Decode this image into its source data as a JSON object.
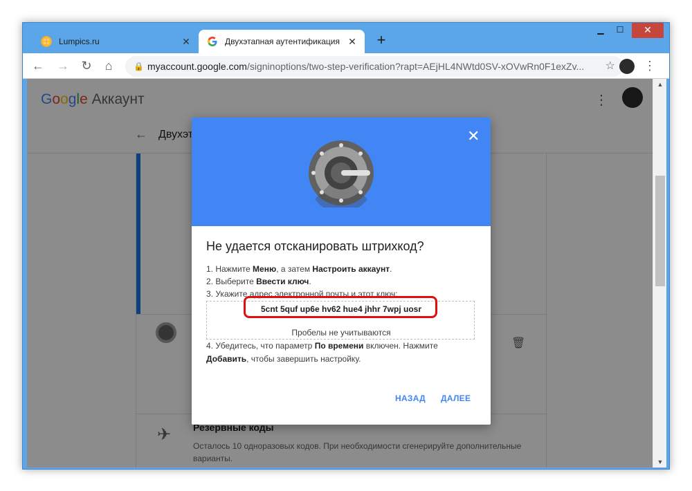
{
  "browser": {
    "tabs": [
      {
        "title": "Lumpics.ru",
        "favicon": "orange-slice-icon",
        "favicon_color": "#f5a623"
      },
      {
        "title": "Двухэтапная аутентификация",
        "favicon": "google-g-icon"
      }
    ],
    "url_host": "myaccount.google.com",
    "url_path": "/signinoptions/two-step-verification?rapt=AEjHL4NWtd0SV-xOVwRn0F1exZv..."
  },
  "page": {
    "logo_google": "Google",
    "logo_suffix": "Аккаунт",
    "subtitle": "Двухэтапная аутентификация",
    "backup": {
      "title": "Резервные коды",
      "description": "Осталось 10 одноразовых кодов. При необходимости сгенерируйте дополнительные варианты."
    }
  },
  "dialog": {
    "title": "Не удается отсканировать штрихкод?",
    "step1_prefix": "1. Нажмите ",
    "step1_menu": "Меню",
    "step1_mid": ", а затем ",
    "step1_setup": "Настроить аккаунт",
    "step1_end": ".",
    "step2_prefix": "2. Выберите ",
    "step2_key": "Ввести ключ",
    "step2_end": ".",
    "step3": "3. Укажите адрес электронной почты и этот ключ:",
    "secret_key": "5cnt 5quf up6e hv62 hue4 jhhr 7wpj uosr",
    "spaces_hint": "Пробелы не учитываются",
    "step4_prefix": "4. Убедитесь, что параметр ",
    "step4_time": "По времени",
    "step4_mid": " включен. Нажмите ",
    "step4_add": "Добавить",
    "step4_end": ", чтобы завершить настройку.",
    "back_label": "НАЗАД",
    "next_label": "ДАЛЕЕ"
  },
  "colors": {
    "dialog_header": "#4285f4",
    "accent": "#4285f4",
    "highlight": "#e01010",
    "window_frame": "#5aa6e8"
  }
}
